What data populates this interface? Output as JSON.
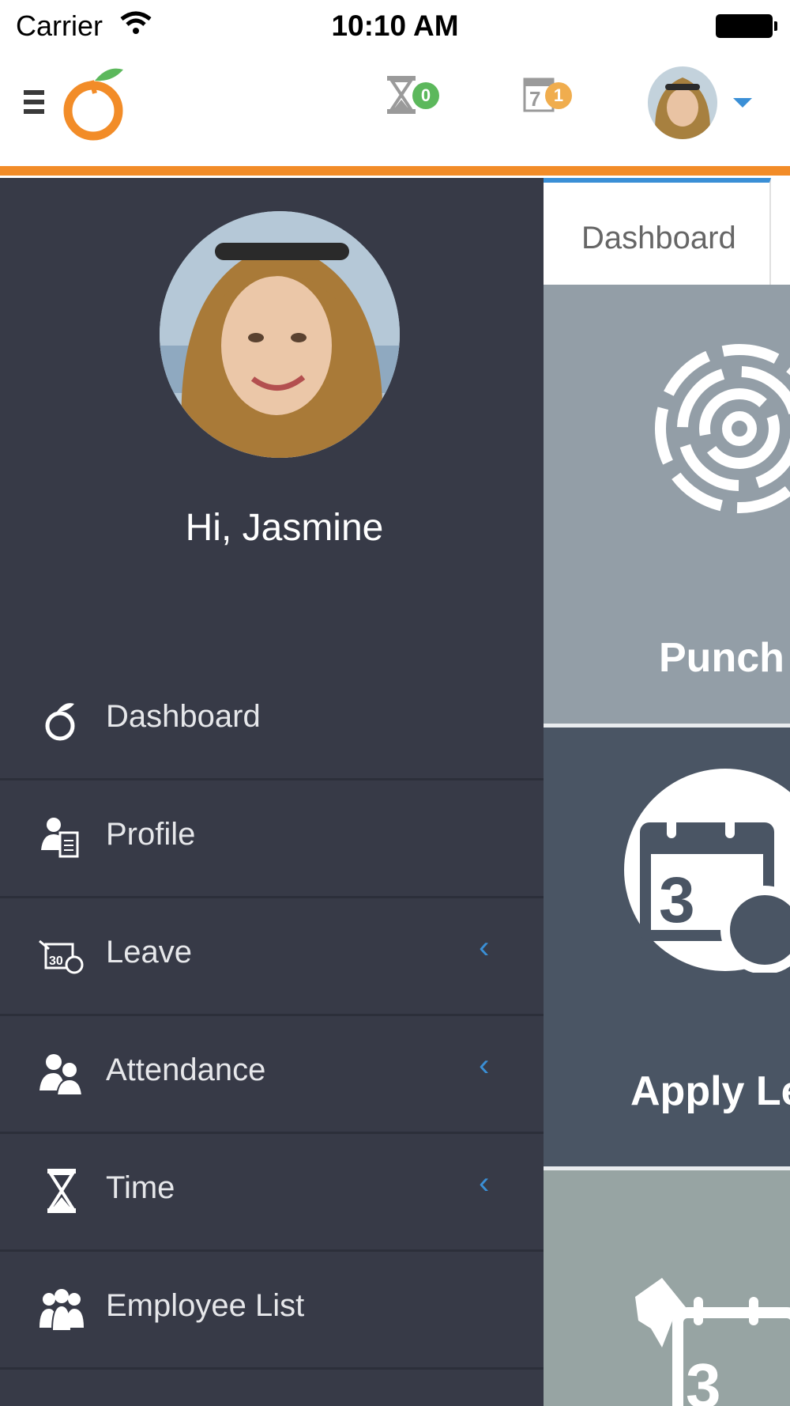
{
  "status_bar": {
    "carrier": "Carrier",
    "time": "10:10 AM"
  },
  "header": {
    "menu_icon": "hamburger-icon",
    "logo": "orange-logo",
    "timesheet_badge": "0",
    "leave_badge": "1",
    "calendar_day": "7",
    "user_menu_icon": "chevron-down-icon"
  },
  "drawer": {
    "greeting": "Hi, Jasmine",
    "items": [
      {
        "label": "Dashboard",
        "icon": "dashboard-icon",
        "has_chevron": false
      },
      {
        "label": "Profile",
        "icon": "profile-icon",
        "has_chevron": false
      },
      {
        "label": "Leave",
        "icon": "leave-icon",
        "has_chevron": true
      },
      {
        "label": "Attendance",
        "icon": "attendance-icon",
        "has_chevron": true
      },
      {
        "label": "Time",
        "icon": "hourglass-icon",
        "has_chevron": true
      },
      {
        "label": "Employee List",
        "icon": "employee-list-icon",
        "has_chevron": false
      }
    ],
    "chevron": "‹"
  },
  "content": {
    "tab": "Dashboard",
    "tiles": [
      {
        "label": "Punch",
        "icon": "fingerprint-icon"
      },
      {
        "label": "Apply Le",
        "icon": "calendar-clock-icon"
      },
      {
        "label": "",
        "icon": "pin-calendar-icon"
      }
    ]
  },
  "colors": {
    "accent_orange": "#f28c28",
    "accent_blue": "#3a8fd6",
    "drawer_bg": "#373a47"
  }
}
